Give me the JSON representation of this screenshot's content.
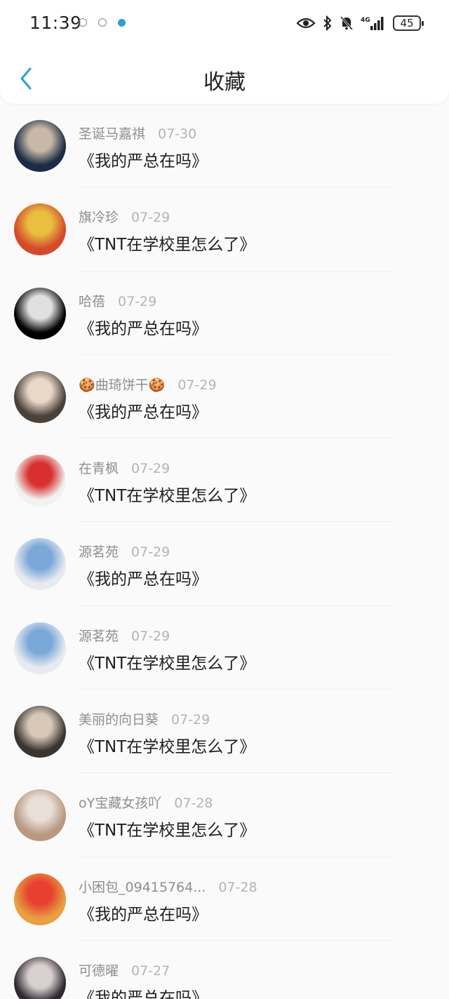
{
  "status_bar": {
    "time": "11:39",
    "battery": "45",
    "network": "4G"
  },
  "nav": {
    "title": "收藏",
    "back_icon": "chevron-left-icon",
    "accent_color": "#2a9fd8"
  },
  "favorites": [
    {
      "author": "圣诞马嘉祺",
      "date": "07-30",
      "title": "《我的严总在吗》",
      "avatar_colors": [
        "#1c2c44",
        "#c8b8a8"
      ]
    },
    {
      "author": "旗冷珍",
      "date": "07-29",
      "title": "《TNT在学校里怎么了》",
      "avatar_colors": [
        "#d44a2a",
        "#e8c040"
      ]
    },
    {
      "author": "哈蓓",
      "date": "07-29",
      "title": "《我的严总在吗》",
      "avatar_colors": [
        "#000000",
        "#e0e0e0"
      ]
    },
    {
      "author": "🍪曲琦饼干🍪",
      "date": "07-29",
      "title": "《我的严总在吗》",
      "avatar_colors": [
        "#4a4038",
        "#e8d8c8"
      ]
    },
    {
      "author": "在青枫",
      "date": "07-29",
      "title": "《TNT在学校里怎么了》",
      "avatar_colors": [
        "#f2f2f2",
        "#d83030"
      ]
    },
    {
      "author": "源茗苑",
      "date": "07-29",
      "title": "《我的严总在吗》",
      "avatar_colors": [
        "#e8eaf0",
        "#7aa8d8"
      ]
    },
    {
      "author": "源茗苑",
      "date": "07-29",
      "title": "《TNT在学校里怎么了》",
      "avatar_colors": [
        "#e8eaf0",
        "#7aa8d8"
      ]
    },
    {
      "author": "美丽的向日葵",
      "date": "07-29",
      "title": "《TNT在学校里怎么了》",
      "avatar_colors": [
        "#3a3530",
        "#d8c8b8"
      ]
    },
    {
      "author": "oY宝藏女孩吖",
      "date": "07-28",
      "title": "《TNT在学校里怎么了》",
      "avatar_colors": [
        "#b89880",
        "#e8e0d8"
      ]
    },
    {
      "author": "小困包_09415764...",
      "date": "07-28",
      "title": "《我的严总在吗》",
      "avatar_colors": [
        "#e8a040",
        "#e84030"
      ]
    },
    {
      "author": "可德曜",
      "date": "07-27",
      "title": "《我的严总在吗》",
      "avatar_colors": [
        "#302830",
        "#d8d0d0"
      ]
    }
  ]
}
